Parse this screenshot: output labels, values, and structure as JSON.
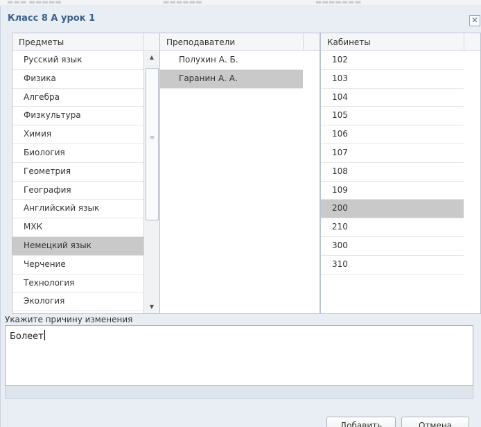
{
  "dialog": {
    "title": "Класс 8 А урок 1",
    "close_glyph": "✕"
  },
  "subjects": {
    "header": "Предметы",
    "selected": "Немецкий язык",
    "items": [
      {
        "label": "Русский язык"
      },
      {
        "label": "Физика"
      },
      {
        "label": "Алгебра"
      },
      {
        "label": "Физкультура"
      },
      {
        "label": "Химия"
      },
      {
        "label": "Биология"
      },
      {
        "label": "Геометрия"
      },
      {
        "label": "География"
      },
      {
        "label": "Английский язык"
      },
      {
        "label": "МХК"
      },
      {
        "label": "Немецкий язык"
      },
      {
        "label": "Черчение"
      },
      {
        "label": "Технология"
      },
      {
        "label": "Экология"
      }
    ]
  },
  "teachers": {
    "header": "Преподаватели",
    "selected": "Гаранин А. А.",
    "items": [
      {
        "label": "Полухин А. Б."
      },
      {
        "label": "Гаранин А. А."
      }
    ]
  },
  "rooms": {
    "header": "Кабинеты",
    "selected": "200",
    "items": [
      {
        "label": "102"
      },
      {
        "label": "103"
      },
      {
        "label": "104"
      },
      {
        "label": "105"
      },
      {
        "label": "106"
      },
      {
        "label": "107"
      },
      {
        "label": "108"
      },
      {
        "label": "109"
      },
      {
        "label": "200"
      },
      {
        "label": "210"
      },
      {
        "label": "300"
      },
      {
        "label": "310"
      }
    ]
  },
  "reason": {
    "label": "Укажите причину изменения",
    "value": "Болеет"
  },
  "buttons": {
    "add": "Добавить",
    "cancel": "Отмена"
  },
  "icons": {
    "scroll_up": "▲",
    "scroll_down": "▼",
    "scroll_grip": "≡"
  }
}
